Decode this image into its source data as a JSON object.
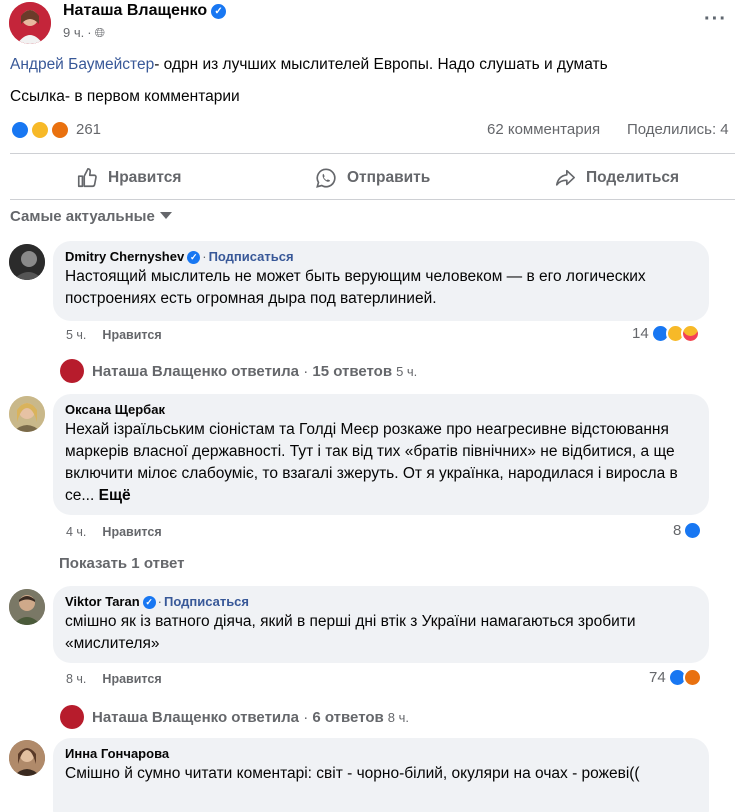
{
  "post": {
    "author": "Наташа Влащенко",
    "time": "9 ч.",
    "privacy_icon": "globe-icon",
    "mention": "Андрей Баумейстер",
    "text_rest": "- одрн из лучших мыслителей Европы. Надо слушать и думать",
    "line2": "Ссылка- в первом комментарии",
    "reactions_count": "261",
    "comments_count": "62 комментария",
    "shares_count": "Поделились: 4"
  },
  "actions": {
    "like": "Нравится",
    "send": "Отправить",
    "share": "Поделиться"
  },
  "filter_label": "Самые актуальные",
  "comments": [
    {
      "author": "Dmitry Chernyshev",
      "follow": "Подписаться",
      "text": "Настоящий мыслитель не может быть верующим человеком — в его логических построениях есть огромная дыра под ватерлинией.",
      "time": "5 ч.",
      "like": "Нравится",
      "reactions": "14",
      "reply_summary": {
        "name": "Наташа Влащенко ответила",
        "count": "15 ответов",
        "time": "5 ч."
      }
    },
    {
      "author": "Оксана Щербак",
      "text": "Нехай ізраїльським сіоністам та Голді Меєр розкаже про неагресивне відстоювання маркерів власної державності. Тут і так від тих «братів північних» не відбитися, а ще включити мілоє слабоуміє, то взагалі зжеруть. От я українка, народилася і виросла в се...",
      "more": "Ещё",
      "time": "4 ч.",
      "like": "Нравится",
      "reactions": "8",
      "show_replies": "Показать 1 ответ"
    },
    {
      "author": "Viktor Taran",
      "follow": "Подписаться",
      "text": "смішно як із ватного діяча, який в перші дні втік з України намагаються зробити «мислителя»",
      "time": "8 ч.",
      "like": "Нравится",
      "reactions": "74",
      "reply_summary": {
        "name": "Наташа Влащенко ответила",
        "count": "6 ответов",
        "time": "8 ч."
      }
    },
    {
      "author": "Инна Гончарова",
      "text": "Смішно й сумно читати коментарі: світ - чорно-білий, окуляри на очах - рожеві(("
    }
  ],
  "colors": {
    "link": "#385898",
    "like_blue": "#1877f2",
    "muted": "#65676b",
    "bubble": "#f0f2f5"
  }
}
